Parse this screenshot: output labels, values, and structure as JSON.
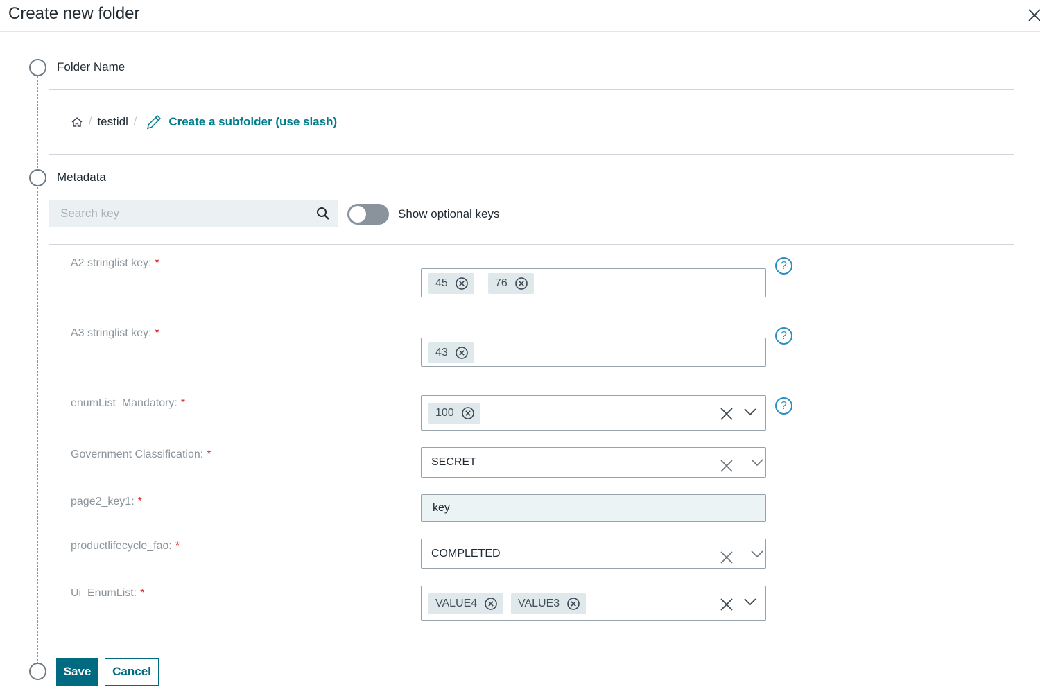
{
  "header": {
    "title": "Create new folder",
    "close_icon": "close-icon"
  },
  "steps": {
    "folder_name": "Folder Name",
    "metadata": "Metadata"
  },
  "breadcrumb": {
    "home_icon": "home-icon",
    "folder": "testidl",
    "separator": "/",
    "action_icon": "pencil-icon",
    "action": "Create a subfolder (use slash)"
  },
  "search": {
    "placeholder": "Search key",
    "value": "",
    "icon": "search-icon"
  },
  "toggle": {
    "label": "Show optional keys",
    "checked": false
  },
  "fields": [
    {
      "label": "A2 stringlist key:",
      "required": "*",
      "type": "stringlist",
      "chips": [
        "45",
        "76"
      ],
      "help": "?"
    },
    {
      "label": "A3 stringlist key:",
      "required": "*",
      "type": "stringlist",
      "chips": [
        "43"
      ],
      "help": "?"
    },
    {
      "label": "enumList_Mandatory:",
      "required": "*",
      "type": "enum-multi",
      "chips": [
        "100"
      ],
      "help": "?"
    },
    {
      "label": "Government Classification:",
      "required": "*",
      "type": "enum-single",
      "value": "SECRET"
    },
    {
      "label": "page2_key1:",
      "required": "*",
      "type": "text",
      "value": "key"
    },
    {
      "label": "productlifecycle_fao:",
      "required": "*",
      "type": "enum-single",
      "value": "COMPLETED"
    },
    {
      "label": "Ui_EnumList:",
      "required": "*",
      "type": "enum-multi",
      "chips": [
        "VALUE4",
        "VALUE3"
      ]
    }
  ],
  "buttons": {
    "save": "Save",
    "cancel": "Cancel"
  },
  "colors": {
    "accent": "#007d8c",
    "primary_button": "#006a80",
    "required": "#d42a2a",
    "help": "#2a8fc0"
  }
}
